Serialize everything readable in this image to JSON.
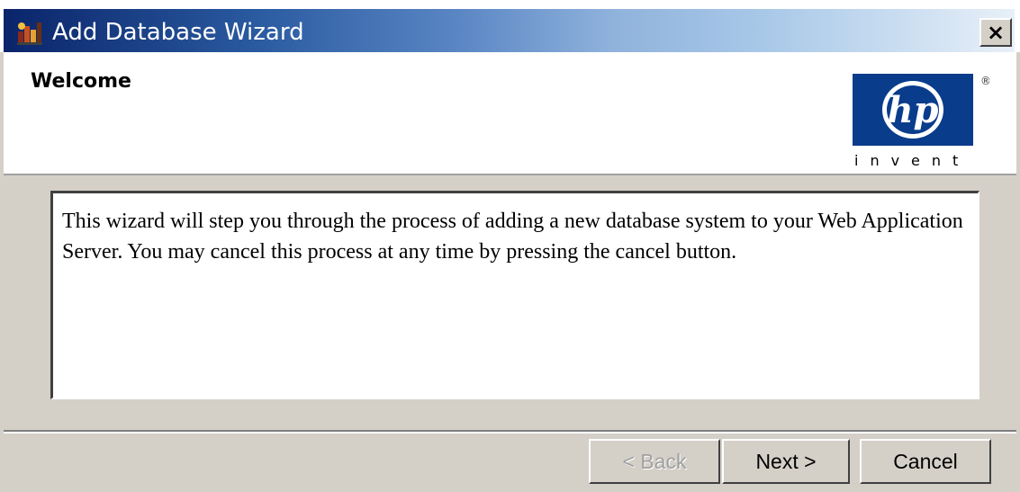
{
  "window": {
    "title": "Add Database Wizard",
    "close_label": "×"
  },
  "header": {
    "title": "Welcome"
  },
  "logo": {
    "brand": "hp",
    "tagline": "invent",
    "registered": "®"
  },
  "content": {
    "text": "This wizard will step you through the process of adding a new database system to your Web Application Server. You may cancel this process at any time by pressing the cancel button."
  },
  "buttons": {
    "back": "< Back",
    "next": "Next >",
    "cancel": "Cancel"
  },
  "colors": {
    "titlebar_start": "#0a246a",
    "titlebar_end": "#e8f0f8",
    "dialog_bg": "#d4d0c8",
    "logo_blue": "#0a3c8c"
  },
  "icons": {
    "app": "database-wizard-icon",
    "close": "close-icon"
  }
}
